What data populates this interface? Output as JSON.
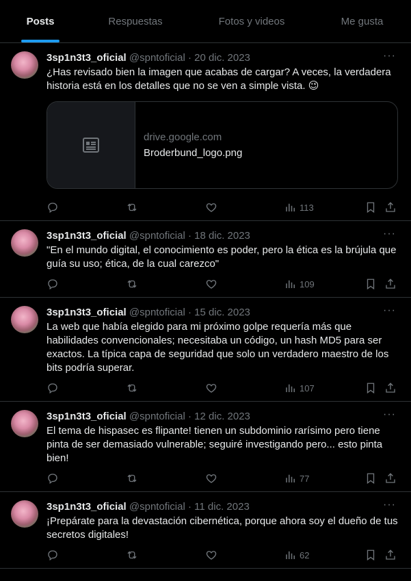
{
  "tabs": [
    {
      "label": "Posts",
      "active": true
    },
    {
      "label": "Respuestas"
    },
    {
      "label": "Fotos y videos"
    },
    {
      "label": "Me gusta"
    }
  ],
  "posts": [
    {
      "name": "3sp1n3t3_oficial",
      "handle": "@spntoficial",
      "date": "20 dic. 2023",
      "text": "¿Has revisado bien la imagen que acabas de cargar? A veces, la verdadera historia está en los detalles que no se ven a simple vista. 😉",
      "card": {
        "domain": "drive.google.com",
        "title": "Broderbund_logo.png"
      },
      "views": "113"
    },
    {
      "name": "3sp1n3t3_oficial",
      "handle": "@spntoficial",
      "date": "18 dic. 2023",
      "text": "\"En el mundo digital, el conocimiento es poder, pero la ética es la brújula que guía su uso; ética, de la cual carezco\"",
      "views": "109"
    },
    {
      "name": "3sp1n3t3_oficial",
      "handle": "@spntoficial",
      "date": "15 dic. 2023",
      "text": "La web que había elegido para mi próximo golpe requería más que habilidades convencionales; necesitaba un código, un hash MD5 para ser exactos. La típica capa de seguridad que solo un verdadero maestro de los bits podría superar.",
      "views": "107"
    },
    {
      "name": "3sp1n3t3_oficial",
      "handle": "@spntoficial",
      "date": "12 dic. 2023",
      "text": "El tema de hispasec es flipante! tienen un subdominio rarísimo pero tiene pinta de ser demasiado vulnerable; seguiré investigando pero... esto pinta bien!",
      "views": "77"
    },
    {
      "name": "3sp1n3t3_oficial",
      "handle": "@spntoficial",
      "date": "11 dic. 2023",
      "text": "¡Prepárate para la devastación cibernética, porque ahora soy el dueño de tus secretos digitales!",
      "views": "62"
    }
  ],
  "icons": {
    "reply": "reply-icon",
    "repost": "repost-icon",
    "like": "like-icon",
    "views": "views-icon",
    "bookmark": "bookmark-icon",
    "share": "share-icon",
    "more": "more-icon",
    "article": "article-icon"
  },
  "colors": {
    "accent": "#1d9bf0",
    "muted": "#71767b",
    "border": "#2f3336"
  }
}
